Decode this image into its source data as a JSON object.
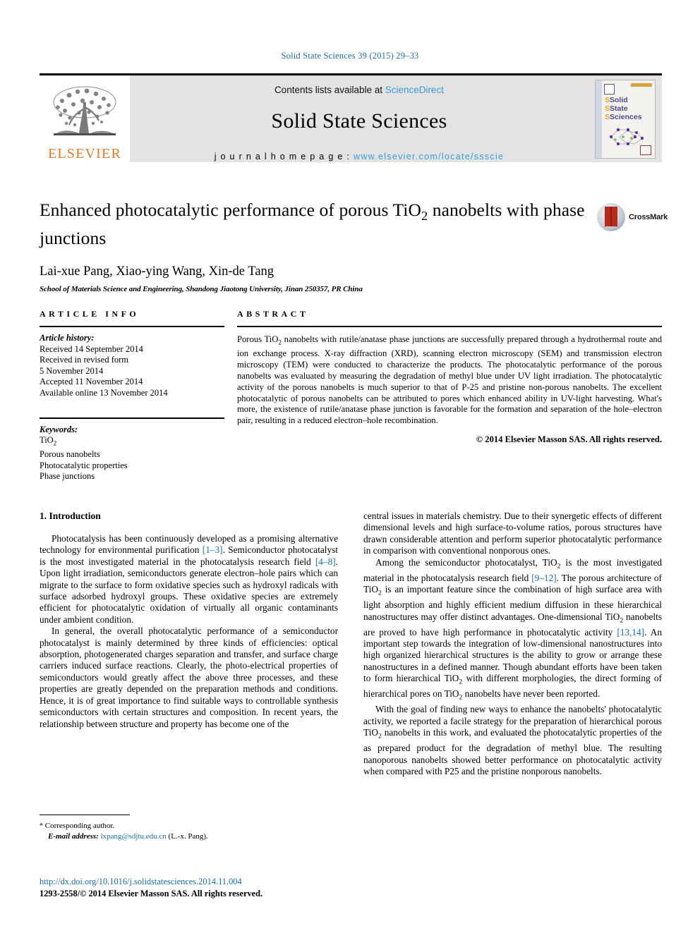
{
  "running_head": "Solid State Sciences 39 (2015) 29–33",
  "masthead": {
    "publisher_name": "ELSEVIER",
    "contents_prefix": "Contents lists available at ",
    "sciencedirect": "ScienceDirect",
    "journal_title": "Solid State Sciences",
    "homepage_prefix": "j o u r n a l   h o m e p a g e :  ",
    "homepage_url": "www.elsevier.com/locate/ssscie",
    "cover": {
      "line1": "Solid",
      "line2": "State",
      "line3": "Sciences"
    }
  },
  "article": {
    "title": "Enhanced photocatalytic performance of porous TiO2 nanobelts with phase junctions",
    "title_part1": "Enhanced photocatalytic performance of porous TiO",
    "title_sub": "2",
    "title_part2": " nanobelts with phase junctions",
    "crossmark_label": "CrossMark",
    "authors": "Lai-xue Pang, Xiao-ying Wang, Xin-de Tang",
    "author_marker": "*",
    "affiliation": "School of Materials Science and Engineering, Shandong Jiaotong University, Jinan 250357, PR China"
  },
  "article_info": {
    "heading": "ARTICLE INFO",
    "history_label": "Article history:",
    "history": [
      "Received 14 September 2014",
      "Received in revised form",
      "5 November 2014",
      "Accepted 11 November 2014",
      "Available online 13 November 2014"
    ],
    "keywords_label": "Keywords:",
    "keywords": [
      "TiO2",
      "Porous nanobelts",
      "Photocatalytic properties",
      "Phase junctions"
    ],
    "keyword_tio2_base": "TiO",
    "keyword_tio2_sub": "2"
  },
  "abstract": {
    "heading": "ABSTRACT",
    "text_p1": "Porous TiO",
    "text_p1_sub": "2",
    "text_p2": " nanobelts with rutile/anatase phase junctions are successfully prepared through a hydrothermal route and ion exchange process. X-ray diffraction (XRD), scanning electron microscopy (SEM) and transmission electron microscopy (TEM) were conducted to characterize the products. The photocatalytic performance of the porous nanobelts was evaluated by measuring the degradation of methyl blue under UV light irradiation. The photocatalytic activity of the porous nanobelts is much superior to that of P-25 and pristine non-porous nanobelts. The excellent photocatalytic of porous nanobelts can be attributed to pores which enhanced ability in UV-light harvesting. What's more, the existence of rutile/anatase phase junction is favorable for the formation and separation of the hole–electron pair, resulting in a reduced electron–hole recombination.",
    "copyright": "© 2014 Elsevier Masson SAS. All rights reserved."
  },
  "body": {
    "section_heading": "1. Introduction",
    "left_paragraphs": [
      {
        "seg": [
          {
            "t": "Photocatalysis has been continuously developed as a promising alternative technology for environmental purification ",
            "k": "n"
          },
          {
            "t": "[1–3]",
            "k": "r"
          },
          {
            "t": ". Semiconductor photocatalyst is the most investigated material in the photocatalysis research field ",
            "k": "n"
          },
          {
            "t": "[4–8]",
            "k": "r"
          },
          {
            "t": ". Upon light irradiation, semiconductors generate electron–hole pairs which can migrate to the surface to form oxidative species such as hydroxyl radicals with surface adsorbed hydroxyl groups. These oxidative species are extremely efficient for photocatalytic oxidation of virtually all organic contaminants under ambient condition.",
            "k": "n"
          }
        ]
      },
      {
        "seg": [
          {
            "t": "In general, the overall photocatalytic performance of a semiconductor photocatalyst is mainly determined by three kinds of efficiencies: optical absorption, photogenerated charges separation and transfer, and surface charge carriers induced surface reactions. Clearly, the photo-electrical properties of semiconductors would greatly affect the above three processes, and these properties are greatly depended on the preparation methods and conditions. Hence, it is of great importance to find suitable ways to controllable synthesis semiconductors with certain structures and composition. In recent years, the relationship between structure and property has become one of the",
            "k": "n"
          }
        ]
      }
    ],
    "right_paragraphs": [
      {
        "indent": false,
        "seg": [
          {
            "t": "central issues in materials chemistry. Due to their synergetic effects of different dimensional levels and high surface-to-volume ratios, porous structures have drawn considerable attention and perform superior photocatalytic performance in comparison with conventional nonporous ones.",
            "k": "n"
          }
        ]
      },
      {
        "indent": true,
        "seg": [
          {
            "t": "Among the semiconductor photocatalyst, TiO",
            "k": "n"
          },
          {
            "t": "2",
            "k": "s"
          },
          {
            "t": " is the most investigated material in the photocatalysis research field ",
            "k": "n"
          },
          {
            "t": "[9–12]",
            "k": "r"
          },
          {
            "t": ". The porous architecture of TiO",
            "k": "n"
          },
          {
            "t": "2",
            "k": "s"
          },
          {
            "t": " is an important feature since the combination of high surface area with light absorption and highly efficient medium diffusion in these hierarchical nanostructures may offer distinct advantages. One-dimensional TiO",
            "k": "n"
          },
          {
            "t": "2",
            "k": "s"
          },
          {
            "t": " nanobelts are proved to have high performance in photocatalytic activity ",
            "k": "n"
          },
          {
            "t": "[13,14]",
            "k": "r"
          },
          {
            "t": ". An important step towards the integration of low-dimensional nanostructures into high organized hierarchical structures is the ability to grow or arrange these nanostructures in a defined manner. Though abundant efforts have been taken to form hierarchical TiO",
            "k": "n"
          },
          {
            "t": "2",
            "k": "s"
          },
          {
            "t": " with different morphologies, the direct forming of hierarchical pores on TiO",
            "k": "n"
          },
          {
            "t": "2",
            "k": "s"
          },
          {
            "t": " nanobelts have never been reported.",
            "k": "n"
          }
        ]
      },
      {
        "indent": true,
        "seg": [
          {
            "t": "With the goal of finding new ways to enhance the nanobelts' photocatalytic activity, we reported a facile strategy for the preparation of hierarchical porous TiO",
            "k": "n"
          },
          {
            "t": "2",
            "k": "s"
          },
          {
            "t": " nanobelts in this work, and evaluated the photocatalytic properties of the as prepared product for the degradation of methyl blue. The resulting nanoporous nanobelts showed better performance on photocatalytic activity when compared with P25 and the pristine nonporous nanobelts.",
            "k": "n"
          }
        ]
      }
    ]
  },
  "footer": {
    "corresponding_star": "*",
    "corresponding_label": " Corresponding author.",
    "email_label": "E-mail address:",
    "email": "lxpang@sdjtu.edu.cn",
    "email_suffix": " (L.-x. Pang).",
    "doi": "http://dx.doi.org/10.1016/j.solidstatesciences.2014.11.004",
    "issn_line": "1293-2558/© 2014 Elsevier Masson SAS. All rights reserved."
  },
  "colors": {
    "link": "#1a6ea8",
    "sciencedirect": "#3a9bd9",
    "elsevier_orange": "#e87722",
    "masthead_bg": "#e3e3e3",
    "crossmark_red": "#b72b1b"
  }
}
